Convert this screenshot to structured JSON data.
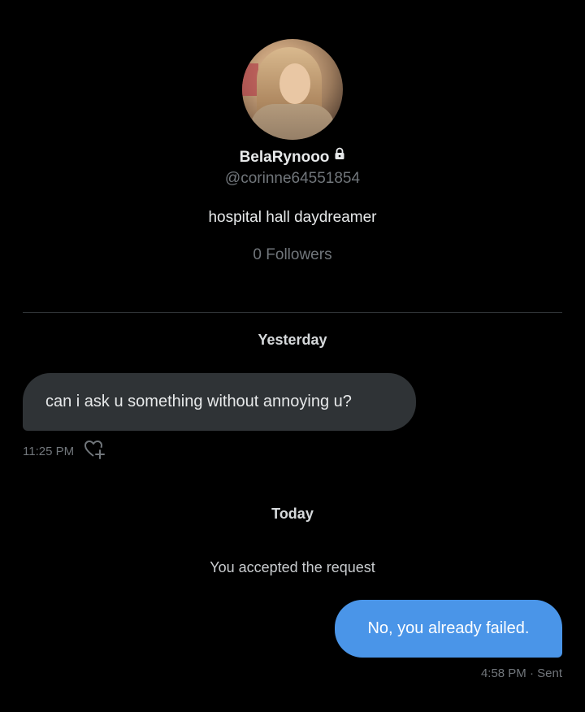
{
  "profile": {
    "display_name": "BelaRynooo",
    "handle": "@corinne64551854",
    "bio": "hospital hall daydreamer",
    "followers": "0 Followers",
    "locked_icon": "lock-icon"
  },
  "conversation": {
    "day_yesterday": "Yesterday",
    "incoming_message": "can i ask u something without annoying u?",
    "incoming_time": "11:25 PM",
    "react_icon": "heart-plus-icon",
    "day_today": "Today",
    "system_message": "You accepted the request",
    "outgoing_message": "No, you already failed.",
    "outgoing_meta": "4:58 PM · Sent"
  },
  "colors": {
    "background": "#000000",
    "incoming_bubble": "#2f3336",
    "outgoing_bubble": "#4a95e8",
    "secondary_text": "#71767b"
  }
}
